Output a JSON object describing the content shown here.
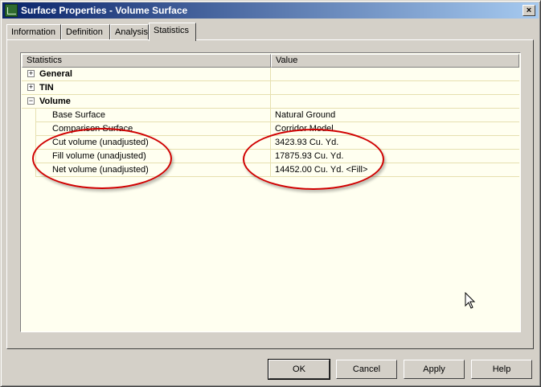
{
  "window": {
    "title": "Surface Properties - Volume Surface",
    "close_glyph": "×"
  },
  "tabs": [
    {
      "label": "Information"
    },
    {
      "label": "Definition"
    },
    {
      "label": "Analysis"
    },
    {
      "label": "Statistics",
      "active": true
    }
  ],
  "grid": {
    "columns": [
      "Statistics",
      "Value"
    ],
    "rows": [
      {
        "label": "General",
        "value": "",
        "expander": "+"
      },
      {
        "label": "TIN",
        "value": "",
        "expander": "+"
      },
      {
        "label": "Volume",
        "value": "",
        "expander": "−"
      },
      {
        "label": "Base Surface",
        "value": "Natural Ground"
      },
      {
        "label": "Comparison Surface",
        "value": "Corridor Model"
      },
      {
        "label": "Cut volume (unadjusted)",
        "value": "3423.93 Cu. Yd."
      },
      {
        "label": "Fill volume (unadjusted)",
        "value": "17875.93 Cu. Yd."
      },
      {
        "label": "Net volume (unadjusted)",
        "value": "14452.00 Cu. Yd. <Fill>"
      }
    ]
  },
  "buttons": {
    "ok": "OK",
    "cancel": "Cancel",
    "apply": "Apply",
    "help": "Help"
  },
  "annotation_color": "#d00000",
  "icons": [
    "surface-app-icon",
    "close-icon",
    "mouse-cursor-icon"
  ]
}
